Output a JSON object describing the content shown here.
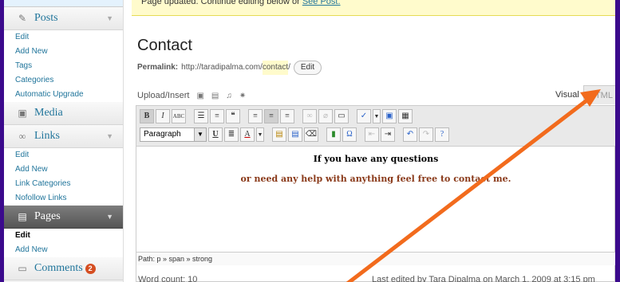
{
  "notice": {
    "text": "Page updated. Continue editing below or ",
    "link": "See Post."
  },
  "sidebar": {
    "posts": {
      "label": "Posts",
      "items": [
        "Edit",
        "Add New",
        "Tags",
        "Categories",
        "Automatic Upgrade"
      ]
    },
    "media": {
      "label": "Media"
    },
    "links": {
      "label": "Links",
      "items": [
        "Edit",
        "Add New",
        "Link Categories",
        "Nofollow Links"
      ]
    },
    "pages": {
      "label": "Pages",
      "items": [
        "Edit",
        "Add New"
      ]
    },
    "comments": {
      "label": "Comments",
      "badge": "2"
    }
  },
  "editor": {
    "title": "Contact",
    "permalink_label": "Permalink:",
    "permalink_base": "http://taradipalma.com/",
    "permalink_slug": "contact",
    "permalink_end": "/",
    "permalink_edit": "Edit",
    "upload_label": "Upload/Insert",
    "tab_visual": "Visual",
    "tab_html": "HTML",
    "format_select": "Paragraph",
    "line1": "If you have any questions",
    "line2": "or need any help with anything feel free to contact me.",
    "path": "Path: p » span » strong",
    "word_count": "Word count: 10",
    "last_edited": "Last edited by Tara Dipalma on March 1, 2009 at 3:15 pm"
  },
  "colors": {
    "frame": "#3b0a8c",
    "arrow": "#f26b1d",
    "link": "#21759b"
  }
}
